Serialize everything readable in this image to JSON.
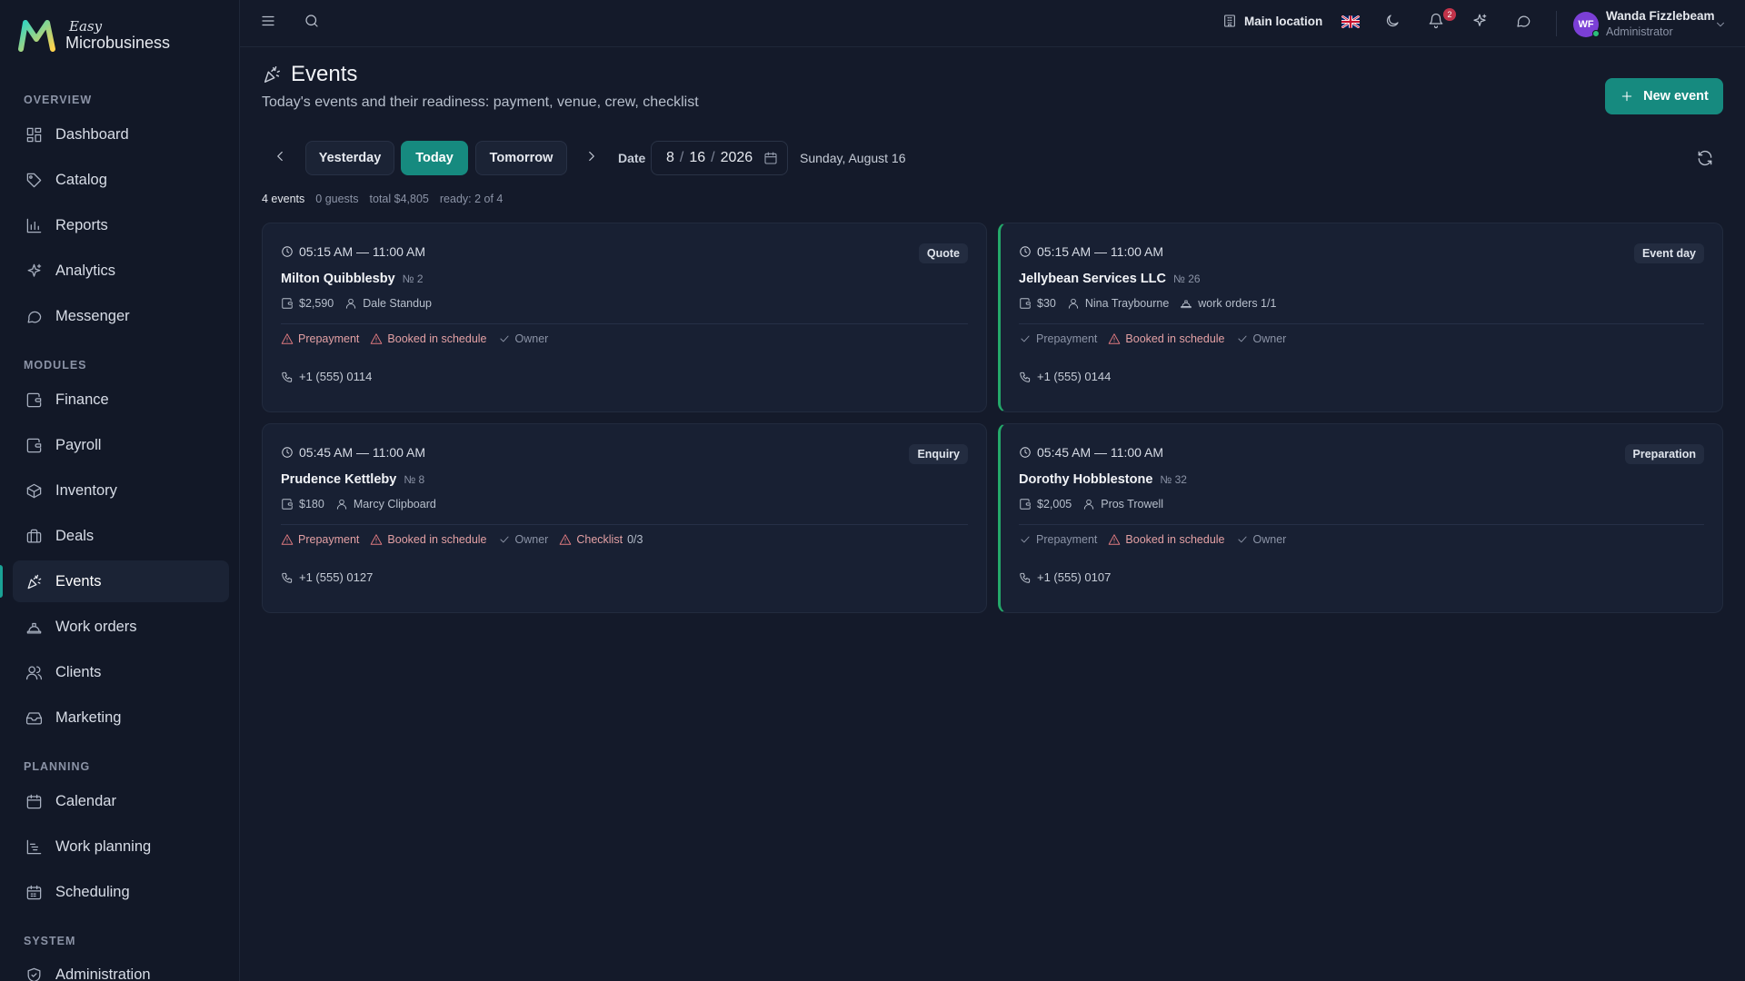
{
  "app": {
    "logo_easy": "Easy",
    "logo_name": "Microbusiness"
  },
  "sidebar": {
    "sections": [
      "Overview",
      "Modules",
      "Planning",
      "System"
    ],
    "items": [
      {
        "label": "Dashboard",
        "icon": "dashboard-icon"
      },
      {
        "label": "Catalog",
        "icon": "tag-icon"
      },
      {
        "label": "Reports",
        "icon": "bar-chart-icon"
      },
      {
        "label": "Analytics",
        "icon": "sparkles-icon"
      },
      {
        "label": "Messenger",
        "icon": "chat-icon"
      },
      {
        "label": "Finance",
        "icon": "wallet-icon"
      },
      {
        "label": "Payroll",
        "icon": "wallet-icon"
      },
      {
        "label": "Inventory",
        "icon": "box-icon"
      },
      {
        "label": "Deals",
        "icon": "briefcase-icon"
      },
      {
        "label": "Events",
        "icon": "party-icon",
        "active": true
      },
      {
        "label": "Work orders",
        "icon": "hardhat-icon"
      },
      {
        "label": "Clients",
        "icon": "users-icon"
      },
      {
        "label": "Marketing",
        "icon": "inbox-icon"
      },
      {
        "label": "Calendar",
        "icon": "calendar-icon"
      },
      {
        "label": "Work planning",
        "icon": "gantt-icon"
      },
      {
        "label": "Scheduling",
        "icon": "calendar-grid-icon"
      },
      {
        "label": "Administration",
        "icon": "shield-icon"
      }
    ]
  },
  "topbar": {
    "location": "Main location",
    "notifications_count": "2",
    "user": {
      "initials": "WF",
      "name": "Wanda Fizzlebeam",
      "role": "Administrator"
    }
  },
  "page": {
    "title": "Events",
    "subtitle": "Today's events and their readiness: payment, venue, crew, checklist",
    "new_button": "New event"
  },
  "date_nav": {
    "yesterday": "Yesterday",
    "today": "Today",
    "tomorrow": "Tomorrow",
    "date_label": "Date",
    "month": "8",
    "day": "16",
    "year": "2026",
    "long_date": "Sunday, August 16"
  },
  "summary": {
    "events": "4 events",
    "guests": "0 guests",
    "total": "total $4,805",
    "ready": "ready: 2 of 4"
  },
  "events": [
    {
      "time": "05:15 AM — 11:00 AM",
      "status": "Quote",
      "name": "Milton Quibblesby",
      "number": "№ 2",
      "amount": "$2,590",
      "person": "Dale Standup",
      "work_orders": "",
      "checks": [
        {
          "label": "Prepayment",
          "state": "warn"
        },
        {
          "label": "Booked in schedule",
          "state": "warn"
        },
        {
          "label": "Owner",
          "state": "ok"
        }
      ],
      "phone": "+1 (555) 0114"
    },
    {
      "time": "05:15 AM — 11:00 AM",
      "status": "Event day",
      "name": "Jellybean Services LLC",
      "number": "№ 26",
      "amount": "$30",
      "person": "Nina Traybourne",
      "work_orders": "work orders 1/1",
      "checks": [
        {
          "label": "Prepayment",
          "state": "ok"
        },
        {
          "label": "Booked in schedule",
          "state": "warn"
        },
        {
          "label": "Owner",
          "state": "ok"
        }
      ],
      "phone": "+1 (555) 0144"
    },
    {
      "time": "05:45 AM — 11:00 AM",
      "status": "Enquiry",
      "name": "Prudence Kettleby",
      "number": "№ 8",
      "amount": "$180",
      "person": "Marcy Clipboard",
      "work_orders": "",
      "checks": [
        {
          "label": "Prepayment",
          "state": "warn"
        },
        {
          "label": "Booked in schedule",
          "state": "warn"
        },
        {
          "label": "Owner",
          "state": "ok"
        },
        {
          "label": "Checklist",
          "count": "0/3",
          "state": "warn"
        }
      ],
      "phone": "+1 (555) 0127"
    },
    {
      "time": "05:45 AM — 11:00 AM",
      "status": "Preparation",
      "name": "Dorothy Hobblestone",
      "number": "№ 32",
      "amount": "$2,005",
      "person": "Pros Trowell",
      "work_orders": "",
      "checks": [
        {
          "label": "Prepayment",
          "state": "ok"
        },
        {
          "label": "Booked in schedule",
          "state": "warn"
        },
        {
          "label": "Owner",
          "state": "ok"
        }
      ],
      "phone": "+1 (555) 0107"
    }
  ],
  "colors": {
    "accent": "#168a7f",
    "ready_border": "#24a86a",
    "warning": "#e07a80",
    "background": "#141a2a"
  }
}
